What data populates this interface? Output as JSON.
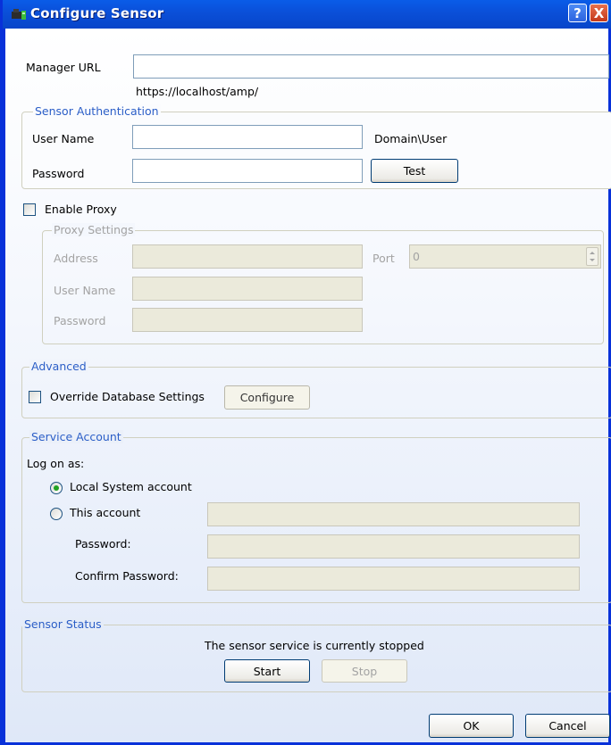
{
  "window": {
    "title": "Configure Sensor",
    "help": "?",
    "close": "X"
  },
  "manager_url": {
    "label": "Manager URL",
    "value": "",
    "hint": "https://localhost/amp/"
  },
  "sensor_auth": {
    "legend": "Sensor Authentication",
    "user_label": "User Name",
    "user_value": "",
    "user_hint": "Domain\\User",
    "password_label": "Password",
    "password_value": "",
    "test_label": "Test"
  },
  "proxy": {
    "enable_label": "Enable Proxy",
    "enabled": false,
    "legend": "Proxy Settings",
    "address_label": "Address",
    "address_value": "",
    "port_label": "Port",
    "port_value": "0",
    "user_label": "User Name",
    "user_value": "",
    "password_label": "Password",
    "password_value": ""
  },
  "advanced": {
    "legend": "Advanced",
    "override_label": "Override Database Settings",
    "override_checked": false,
    "configure_label": "Configure"
  },
  "service_account": {
    "legend": "Service Account",
    "logon_label": "Log on as:",
    "local_label": "Local System account",
    "local_selected": true,
    "this_label": "This account",
    "this_value": "",
    "password_label": "Password:",
    "password_value": "",
    "confirm_label": "Confirm Password:",
    "confirm_value": ""
  },
  "sensor_status": {
    "legend": "Sensor Status",
    "message": "The sensor service is currently stopped",
    "start_label": "Start",
    "stop_label": "Stop"
  },
  "footer": {
    "ok_label": "OK",
    "cancel_label": "Cancel"
  },
  "colors": {
    "title_bar": "#0a55e0",
    "group_legend": "#2b5ec7",
    "selected_radio": "#21a121"
  }
}
